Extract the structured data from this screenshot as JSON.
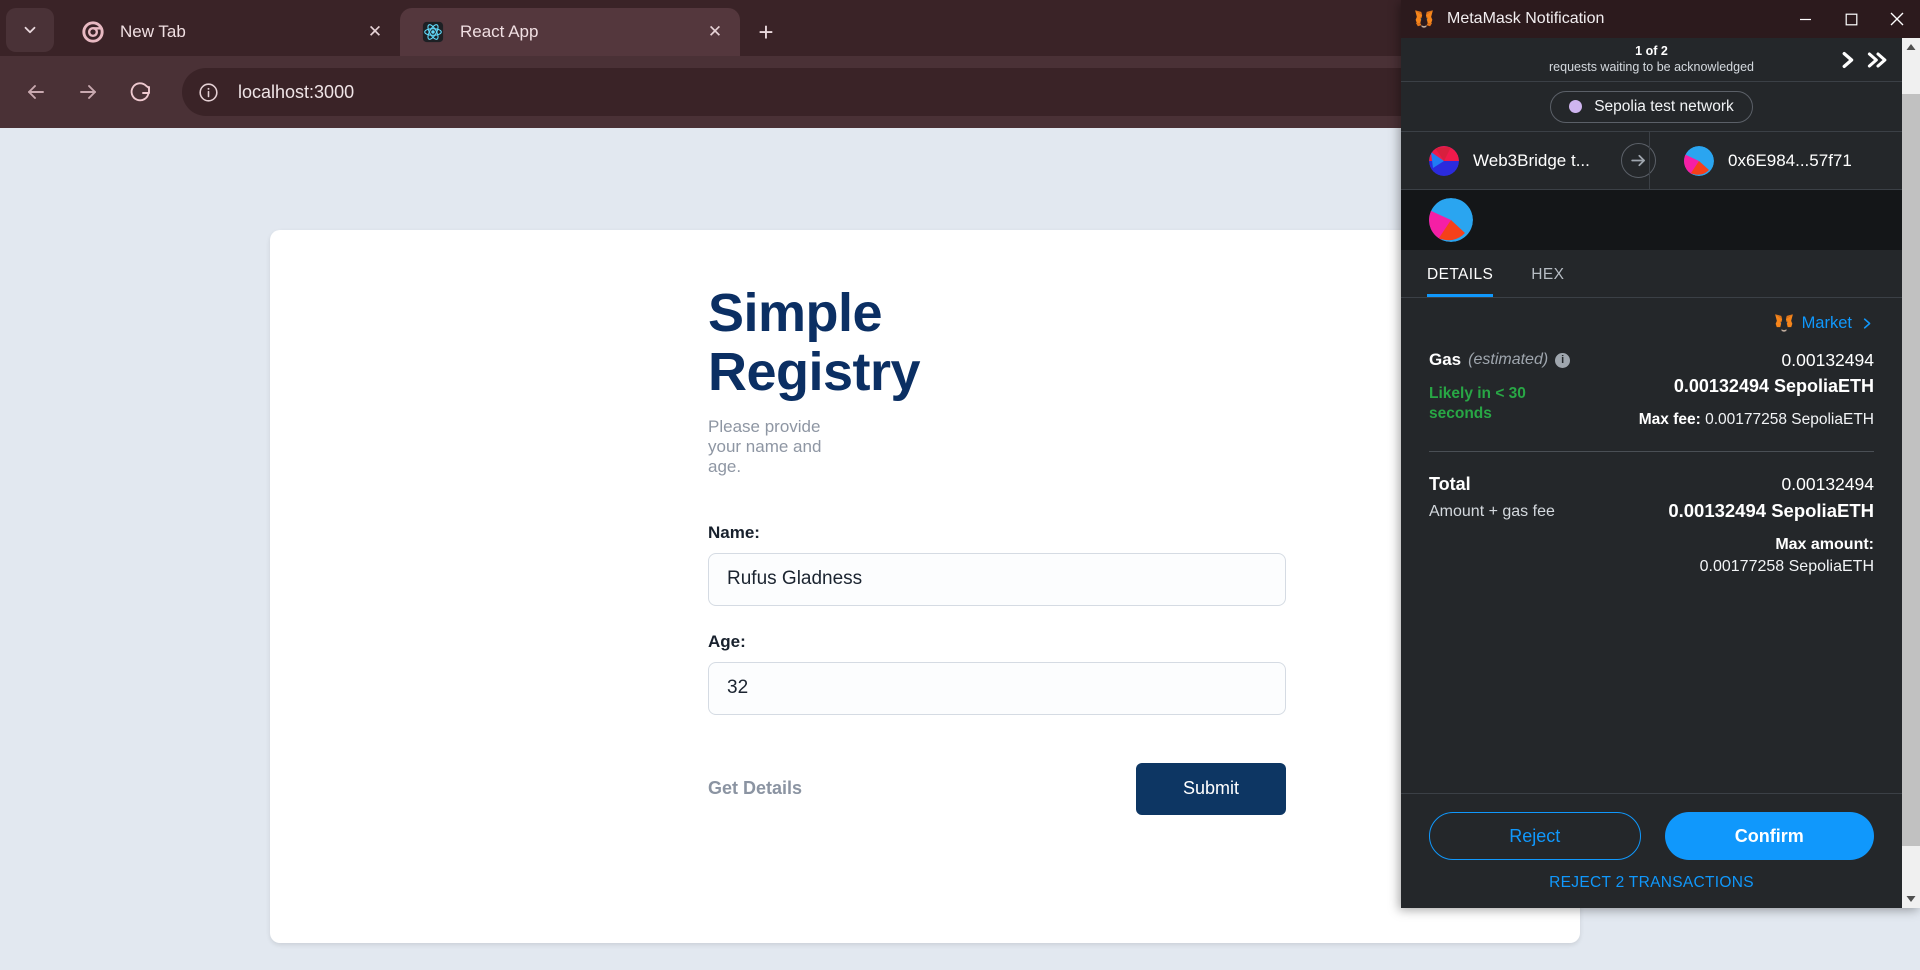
{
  "browser": {
    "tabs": [
      {
        "title": "New Tab",
        "favicon": "chrome-icon",
        "active": false,
        "close_label": "✕"
      },
      {
        "title": "React App",
        "favicon": "react-icon",
        "active": true,
        "close_label": "✕"
      }
    ],
    "new_tab_label": "+",
    "tab_list_label": "▾",
    "toolbar": {
      "back_label": "←",
      "forward_label": "→",
      "reload_label": "↻",
      "site_info_label": "ⓘ",
      "url": "localhost:3000"
    }
  },
  "page": {
    "title": "Simple Registry",
    "subtitle": "Please provide your name and age.",
    "name_label": "Name:",
    "name_value": "Rufus Gladness",
    "name_placeholder": "",
    "age_label": "Age:",
    "age_value": "32",
    "age_placeholder": "",
    "get_details_label": "Get Details",
    "submit_label": "Submit"
  },
  "metamask": {
    "window_title": "MetaMask Notification",
    "window_controls": {
      "minimize": "—",
      "maximize": "☐",
      "close": "✕"
    },
    "requests": {
      "count": "1 of 2",
      "label": "requests waiting to be acknowledged",
      "next_label": "›",
      "last_label": "»"
    },
    "network": {
      "name": "Sepolia test network",
      "dot_color": "#cfb5f0"
    },
    "accounts": {
      "from": "Web3Bridge t...",
      "to": "0x6E984...57f71",
      "arrow_label": "→"
    },
    "tabs": [
      {
        "label": "DETAILS",
        "active": true
      },
      {
        "label": "HEX",
        "active": false
      }
    ],
    "market": {
      "label": "Market",
      "chevron": "›"
    },
    "gas": {
      "title": "Gas",
      "estimated": "(estimated)",
      "info": "i",
      "fiat": "0.00132494",
      "eth": "0.00132494 SepoliaETH",
      "speed": "Likely in < 30 seconds",
      "max_fee_label": "Max fee:",
      "max_fee_value": "0.00177258 SepoliaETH"
    },
    "total": {
      "title": "Total",
      "subtitle": "Amount + gas fee",
      "fiat": "0.00132494",
      "eth": "0.00132494 SepoliaETH",
      "max_amount_label": "Max amount:",
      "max_amount_value": "0.00177258 SepoliaETH"
    },
    "footer": {
      "reject_label": "Reject",
      "confirm_label": "Confirm",
      "reject_all_label": "REJECT 2 TRANSACTIONS"
    },
    "colors": {
      "accent": "#1098fc",
      "success": "#28a745",
      "panel_bg": "#24272a",
      "titlebar_bg": "#2c1a1d"
    }
  }
}
